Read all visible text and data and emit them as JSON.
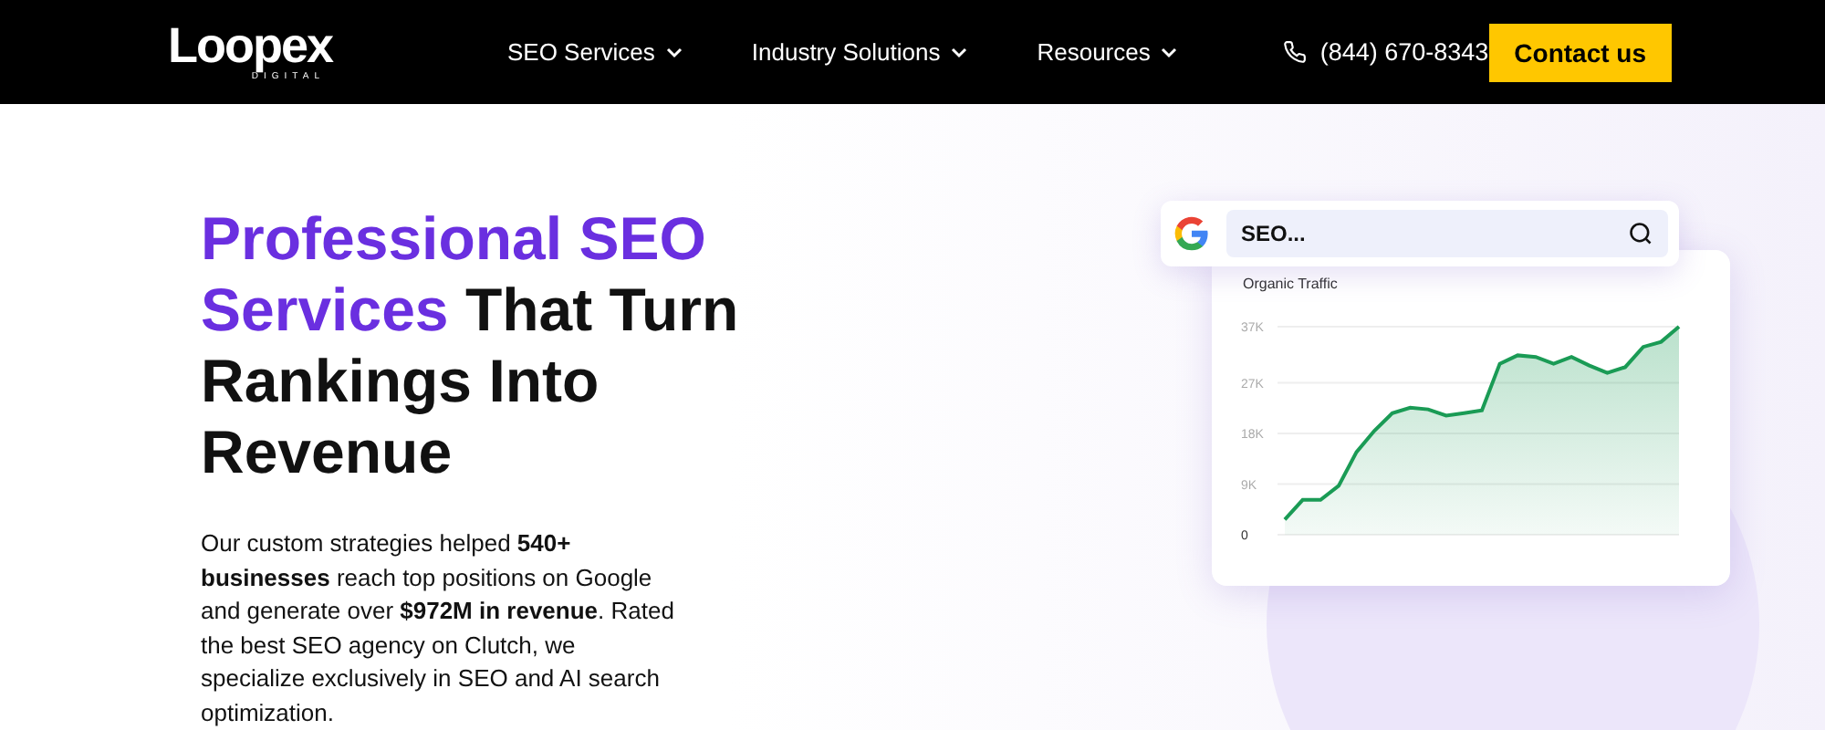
{
  "nav": {
    "logo": "Loopex",
    "logo_sub": "DIGITAL",
    "menu": [
      {
        "label": "SEO Services"
      },
      {
        "label": "Industry Solutions"
      },
      {
        "label": "Resources"
      }
    ],
    "phone": "(844) 670-8343",
    "cta": "Contact us"
  },
  "hero": {
    "heading_highlight": "Professional SEO Services",
    "heading_rest": "That Turn Rankings Into Revenue",
    "body": "Our custom strategies helped **540+ businesses** reach top positions on Google and generate over **$972M in revenue**. Rated the best SEO agency on Clutch, we specialize exclusively in SEO and AI search optimization."
  },
  "search": {
    "value": "SEO..."
  },
  "chart": {
    "chart_data": {
      "type": "area",
      "title": "Organic Traffic",
      "grid": true,
      "ylim": [
        0,
        37
      ],
      "yticks": [
        {
          "value": 0,
          "label": "0"
        },
        {
          "value": 9,
          "label": "9K"
        },
        {
          "value": 18,
          "label": "18K"
        },
        {
          "value": 27,
          "label": "27K"
        },
        {
          "value": 37,
          "label": "37K"
        }
      ],
      "series": [
        {
          "color": "#1a9b55",
          "values": [
            2.7,
            6.2,
            6.2,
            8.7,
            14.7,
            18.5,
            21.6,
            22.6,
            22.3,
            21.2,
            21.6,
            22.1,
            30.4,
            31.9,
            31.6,
            30.4,
            31.6,
            30.1,
            28.8,
            29.8,
            33.4,
            34.3,
            37
          ]
        }
      ]
    }
  }
}
